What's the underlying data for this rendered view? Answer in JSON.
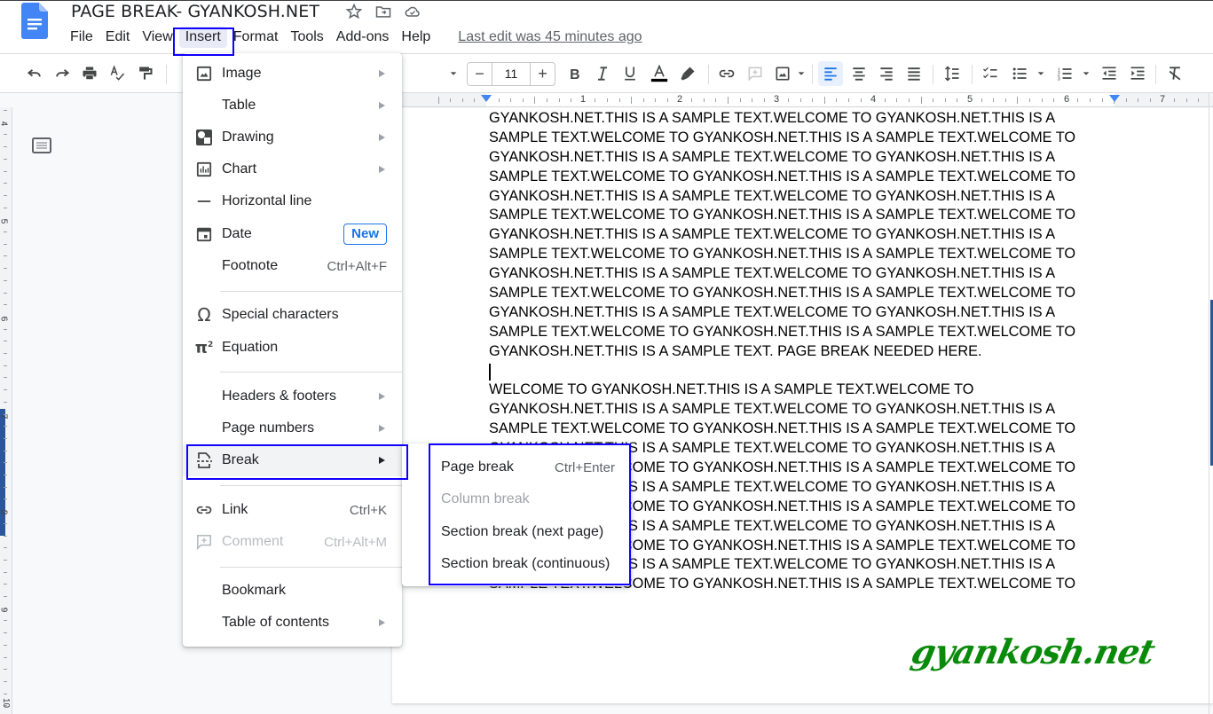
{
  "header": {
    "title": "PAGE BREAK- GYANKOSH.NET",
    "icons": [
      "star-icon",
      "move-to-folder-icon",
      "cloud-saved-icon"
    ],
    "menus": [
      "File",
      "Edit",
      "View",
      "Insert",
      "Format",
      "Tools",
      "Add-ons",
      "Help"
    ],
    "active_menu": "Insert",
    "last_edit": "Last edit was 45 minutes ago"
  },
  "toolbar": {
    "font_size": "11",
    "minus": "−",
    "plus": "+",
    "buttons": [
      "undo",
      "redo",
      "print",
      "spellcheck",
      "paint-format",
      "bold",
      "italic",
      "underline",
      "text-color",
      "highlight",
      "link",
      "comment",
      "image",
      "align-left",
      "align-center",
      "align-right",
      "justify",
      "line-spacing",
      "checklist",
      "bulleted-list",
      "numbered-list",
      "decrease-indent",
      "increase-indent",
      "clear-formatting"
    ],
    "text_color": "#000000",
    "active_align": "align-left"
  },
  "ruler": {
    "numbers": [
      "1",
      "2",
      "3",
      "4",
      "5",
      "6",
      "7"
    ],
    "vertical_numbers": [
      "4",
      "5",
      "6",
      "7",
      "8",
      "9",
      "10"
    ]
  },
  "insert_menu": {
    "items": [
      {
        "label": "Image",
        "icon": "image-icon",
        "submenu": true
      },
      {
        "label": "Table",
        "icon": "",
        "submenu": true
      },
      {
        "label": "Drawing",
        "icon": "drawing-icon",
        "submenu": true
      },
      {
        "label": "Chart",
        "icon": "chart-icon",
        "submenu": true
      },
      {
        "label": "Horizontal line",
        "icon": "horizontal-line-icon"
      },
      {
        "label": "Date",
        "icon": "calendar-icon",
        "badge": "New"
      },
      {
        "label": "Footnote",
        "shortcut": "Ctrl+Alt+F"
      },
      {
        "label": "Special characters",
        "icon": "omega-icon"
      },
      {
        "label": "Equation",
        "icon": "pi-squared-icon"
      },
      {
        "label": "Headers & footers",
        "submenu": true
      },
      {
        "label": "Page numbers",
        "submenu": true
      },
      {
        "label": "Break",
        "icon": "page-break-icon",
        "submenu": true,
        "highlighted": true
      },
      {
        "label": "Link",
        "icon": "link-icon",
        "shortcut": "Ctrl+K"
      },
      {
        "label": "Comment",
        "icon": "add-comment-icon",
        "shortcut": "Ctrl+Alt+M",
        "disabled": true
      },
      {
        "label": "Bookmark"
      },
      {
        "label": "Table of contents",
        "submenu": true
      }
    ]
  },
  "break_menu": {
    "items": [
      {
        "label": "Page break",
        "shortcut": "Ctrl+Enter"
      },
      {
        "label": "Column break",
        "disabled": true
      },
      {
        "label": "Section break (next page)"
      },
      {
        "label": "Section break (continuous)"
      }
    ]
  },
  "document": {
    "lines": [
      "GYANKOSH.NET.THIS IS A SAMPLE TEXT.WELCOME TO GYANKOSH.NET.THIS IS A",
      "SAMPLE TEXT.WELCOME TO GYANKOSH.NET.THIS IS A SAMPLE TEXT.WELCOME TO",
      "GYANKOSH.NET.THIS IS A SAMPLE TEXT.WELCOME TO GYANKOSH.NET.THIS IS A",
      "SAMPLE TEXT.WELCOME TO GYANKOSH.NET.THIS IS A SAMPLE TEXT.WELCOME TO",
      "GYANKOSH.NET.THIS IS A SAMPLE TEXT.WELCOME TO GYANKOSH.NET.THIS IS A",
      "SAMPLE TEXT.WELCOME TO GYANKOSH.NET.THIS IS A SAMPLE TEXT.WELCOME TO",
      "GYANKOSH.NET.THIS IS A SAMPLE TEXT.WELCOME TO GYANKOSH.NET.THIS IS A",
      "SAMPLE TEXT.WELCOME TO GYANKOSH.NET.THIS IS A SAMPLE TEXT.WELCOME TO",
      "GYANKOSH.NET.THIS IS A SAMPLE TEXT.WELCOME TO GYANKOSH.NET.THIS IS A",
      "SAMPLE TEXT.WELCOME TO GYANKOSH.NET.THIS IS A SAMPLE TEXT.WELCOME TO",
      "GYANKOSH.NET.THIS IS A SAMPLE TEXT.WELCOME TO GYANKOSH.NET.THIS IS A",
      "SAMPLE TEXT.WELCOME TO GYANKOSH.NET.THIS IS A SAMPLE TEXT.WELCOME TO",
      "GYANKOSH.NET.THIS IS A SAMPLE TEXT. PAGE BREAK NEEDED HERE.",
      "",
      "WELCOME TO GYANKOSH.NET.THIS IS A SAMPLE TEXT.WELCOME TO",
      "GYANKOSH.NET.THIS IS A SAMPLE TEXT.WELCOME TO GYANKOSH.NET.THIS IS A",
      "SAMPLE TEXT.WELCOME TO GYANKOSH.NET.THIS IS A SAMPLE TEXT.WELCOME TO",
      "GYANKOSH.NET.THIS IS A SAMPLE TEXT.WELCOME TO GYANKOSH.NET.THIS IS A",
      "SAMPLE TEXT.WELCOME TO GYANKOSH.NET.THIS IS A SAMPLE TEXT.WELCOME TO",
      "GYANKOSH.NET.THIS IS A SAMPLE TEXT.WELCOME TO GYANKOSH.NET.THIS IS A",
      "SAMPLE TEXT.WELCOME TO GYANKOSH.NET.THIS IS A SAMPLE TEXT.WELCOME TO",
      "GYANKOSH.NET.THIS IS A SAMPLE TEXT.WELCOME TO GYANKOSH.NET.THIS IS A",
      "SAMPLE TEXT.WELCOME TO GYANKOSH.NET.THIS IS A SAMPLE TEXT.WELCOME TO",
      "GYANKOSH.NET.THIS IS A SAMPLE TEXT.WELCOME TO GYANKOSH.NET.THIS IS A",
      "SAMPLE TEXT.WELCOME TO GYANKOSH.NET.THIS IS A SAMPLE TEXT.WELCOME TO"
    ],
    "cursor_line": 13
  },
  "watermark": "gyankosh.net",
  "colors": {
    "accent": "#1a73e8",
    "annotation_box": "#1100ff",
    "watermark": "#0a8a0a"
  }
}
